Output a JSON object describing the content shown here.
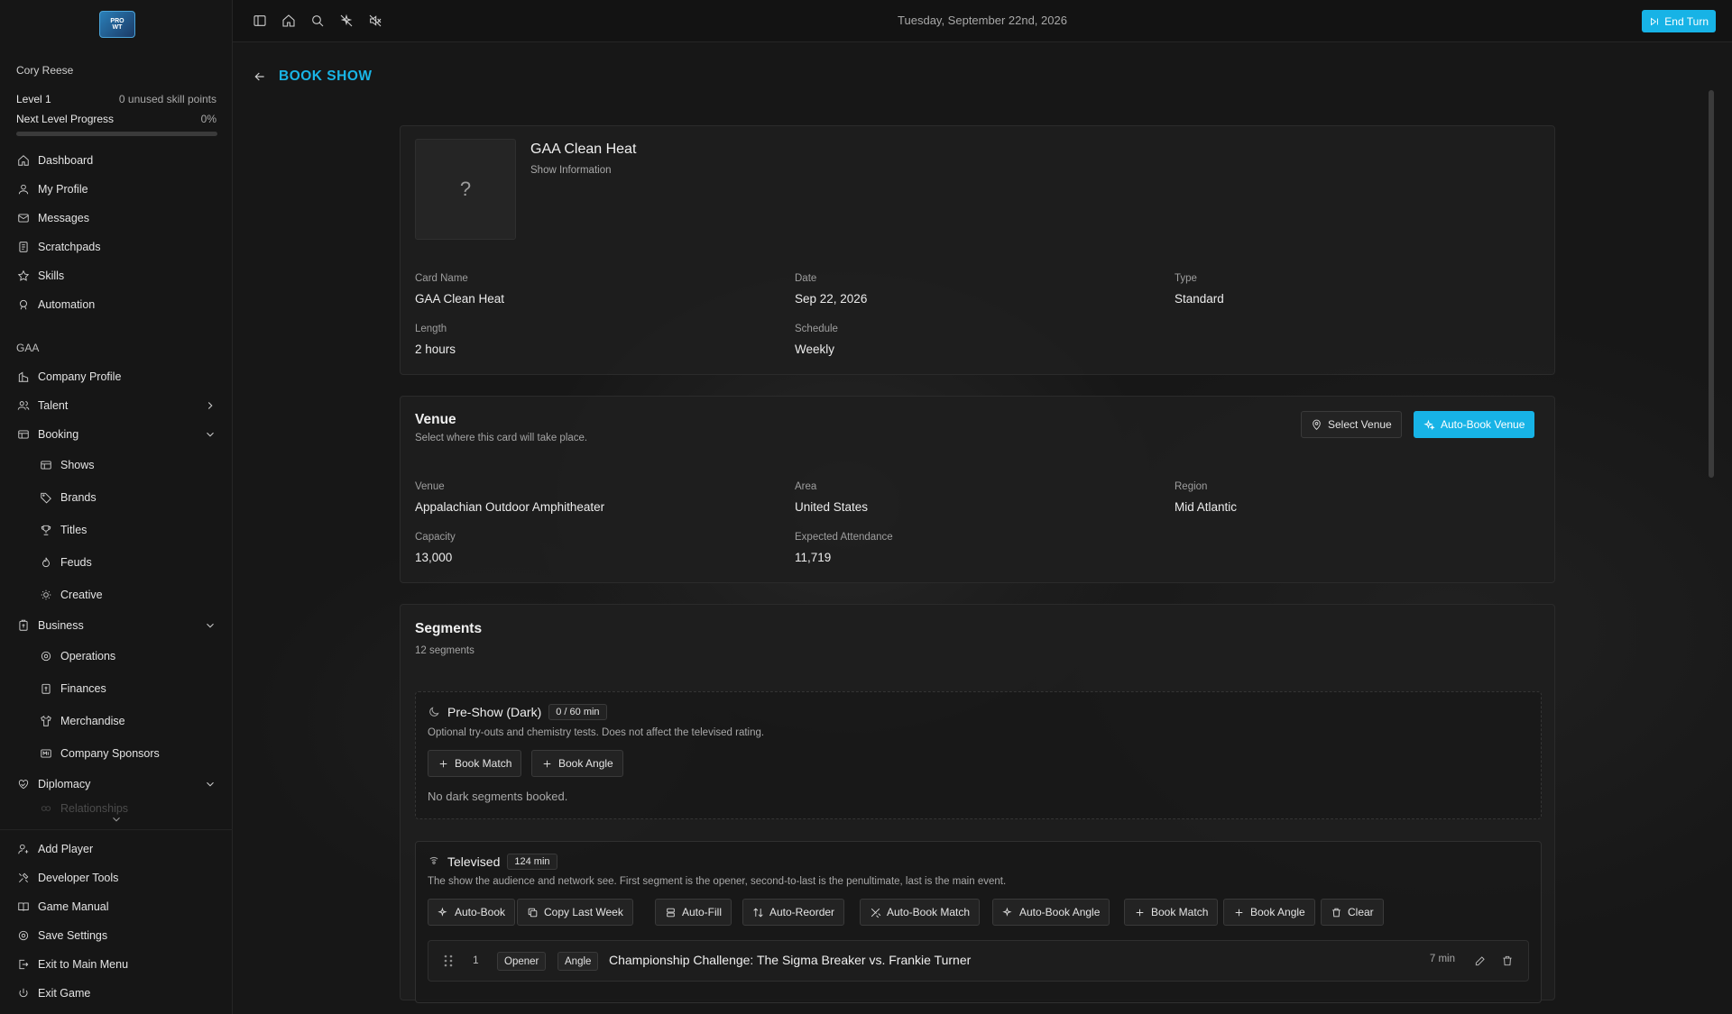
{
  "app": {
    "logo_text": "PRO WRESTLING TYCOON"
  },
  "player": {
    "name": "Cory Reese",
    "level": "Level 1",
    "skill_points": "0 unused skill points",
    "progress_label": "Next Level Progress",
    "progress_pct_text": "0%",
    "progress_value": 0.0
  },
  "nav_main": [
    {
      "label": "Dashboard",
      "icon": "home-icon"
    },
    {
      "label": "My Profile",
      "icon": "user-icon"
    },
    {
      "label": "Messages",
      "icon": "mail-icon"
    },
    {
      "label": "Scratchpads",
      "icon": "notepad-icon"
    },
    {
      "label": "Skills",
      "icon": "star-icon"
    },
    {
      "label": "Automation",
      "icon": "robot-icon"
    }
  ],
  "company_section": "GAA",
  "nav_company": {
    "company_profile": "Company Profile",
    "talent": "Talent",
    "booking": "Booking",
    "booking_items": [
      "Shows",
      "Brands",
      "Titles",
      "Feuds",
      "Creative"
    ],
    "business": "Business",
    "business_items": [
      "Operations",
      "Finances",
      "Merchandise",
      "Company Sponsors"
    ],
    "diplomacy": "Diplomacy",
    "diplomacy_items": [
      "Relationships"
    ]
  },
  "nav_bottom": [
    "Add Player",
    "Developer Tools",
    "Game Manual",
    "Save Settings",
    "Exit to Main Menu",
    "Exit Game"
  ],
  "topbar": {
    "date": "Tuesday, September 22nd, 2026",
    "end_turn": "End Turn"
  },
  "page": {
    "title": "BOOK SHOW"
  },
  "show": {
    "name": "GAA Clean Heat",
    "subtitle": "Show Information",
    "thumb_placeholder": "?",
    "fields": {
      "card_name_label": "Card Name",
      "card_name": "GAA Clean Heat",
      "date_label": "Date",
      "date": "Sep 22, 2026",
      "type_label": "Type",
      "type": "Standard",
      "length_label": "Length",
      "length": "2 hours",
      "schedule_label": "Schedule",
      "schedule": "Weekly"
    }
  },
  "venue": {
    "title": "Venue",
    "subtitle": "Select where this card will take place.",
    "select_btn": "Select Venue",
    "auto_btn": "Auto-Book Venue",
    "fields": {
      "venue_label": "Venue",
      "venue": "Appalachian Outdoor Amphitheater",
      "area_label": "Area",
      "area": "United States",
      "region_label": "Region",
      "region": "Mid Atlantic",
      "capacity_label": "Capacity",
      "capacity": "13,000",
      "attendance_label": "Expected Attendance",
      "attendance": "11,719"
    }
  },
  "segments": {
    "title": "Segments",
    "count": "12 segments",
    "preshow": {
      "title": "Pre-Show (Dark)",
      "pill": "0 / 60 min",
      "desc": "Optional try-outs and chemistry tests. Does not affect the televised rating.",
      "book_match": "Book Match",
      "book_angle": "Book Angle",
      "empty": "No dark segments booked."
    },
    "televised": {
      "title": "Televised",
      "pill": "124 min",
      "desc": "The show the audience and network see. First segment is the opener, second-to-last is the penultimate, last is the main event.",
      "buttons": [
        "Auto-Book",
        "Copy Last Week",
        "Auto-Fill",
        "Auto-Reorder",
        "Auto-Book Match",
        "Auto-Book Angle",
        "Book Match",
        "Book Angle",
        "Clear"
      ]
    },
    "rows": [
      {
        "num": "1",
        "position": "Opener",
        "kind": "Angle",
        "title": "Championship Challenge: The Sigma Breaker vs. Frankie Turner",
        "length": "7 min"
      }
    ]
  },
  "colors": {
    "accent": "#17b3e6",
    "background": "#141414",
    "card": "#1e1e1e"
  }
}
